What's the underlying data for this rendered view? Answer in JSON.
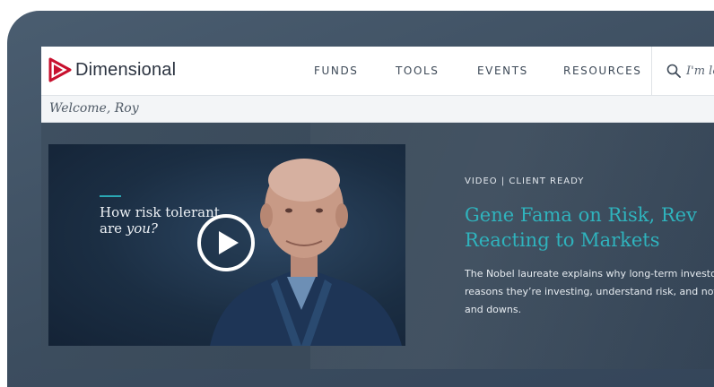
{
  "brand": {
    "name": "Dimensional",
    "accent": "#c8102e"
  },
  "nav": {
    "items": [
      {
        "label": "FUNDS"
      },
      {
        "label": "TOOLS"
      },
      {
        "label": "EVENTS"
      },
      {
        "label": "RESOURCES"
      }
    ]
  },
  "search": {
    "text": "I'm lo"
  },
  "welcome": {
    "text": "Welcome, Roy"
  },
  "video": {
    "line1": "How risk tolerant",
    "line2_prefix": "are ",
    "line2_emphasis": "you?",
    "icon": "play-icon"
  },
  "article": {
    "eyebrow": "VIDEO | CLIENT READY",
    "title_line1": "Gene Fama on Risk, Rev",
    "title_line2": "Reacting to Markets",
    "desc_line1": "The Nobel laureate explains why long-term investo",
    "desc_line2": "reasons they’re investing, understand risk, and not",
    "desc_line3": "and downs.",
    "title_color": "#2fb3bd"
  }
}
